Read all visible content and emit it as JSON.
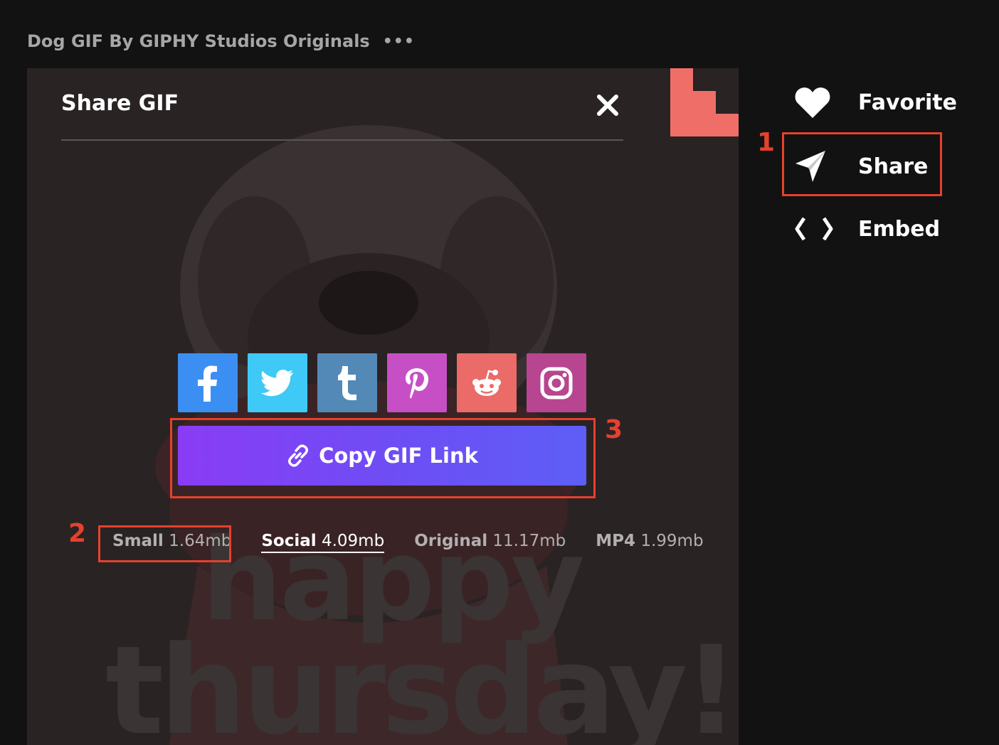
{
  "gif_title": "Dog GIF By GIPHY Studios Originals",
  "more_label": "•••",
  "share_panel": {
    "title": "Share GIF",
    "close_label": "✕",
    "social": [
      {
        "name": "facebook",
        "color": "#3b8ff3",
        "glyph": "f"
      },
      {
        "name": "twitter",
        "color": "#3fc9f6",
        "glyph": "twitter"
      },
      {
        "name": "tumblr",
        "color": "#5389b6",
        "glyph": "t"
      },
      {
        "name": "pinterest",
        "color": "#c74fc6",
        "glyph": "p"
      },
      {
        "name": "reddit",
        "color": "#ea6b67",
        "glyph": "reddit"
      },
      {
        "name": "instagram",
        "color": "#b7458f",
        "glyph": "instagram"
      }
    ],
    "copy_link_label": "Copy GIF Link",
    "sizes": [
      {
        "label": "Small",
        "size": "1.64mb"
      },
      {
        "label": "Social",
        "size": "4.09mb"
      },
      {
        "label": "Original",
        "size": "11.17mb"
      },
      {
        "label": "MP4",
        "size": "1.99mb"
      }
    ]
  },
  "gif_caption": {
    "line1": "happy",
    "line2": "thursday!"
  },
  "actions": [
    {
      "label": "Favorite",
      "icon": "heart-icon"
    },
    {
      "label": "Share",
      "icon": "paper-plane-icon"
    },
    {
      "label": "Embed",
      "icon": "code-brackets-icon"
    }
  ],
  "annotations": [
    "1",
    "2",
    "3"
  ],
  "colors": {
    "accent": "#e5412d",
    "copy_button_start": "#8a3cf5",
    "copy_button_end": "#5e5ef6",
    "corner": "#ef6f68"
  }
}
